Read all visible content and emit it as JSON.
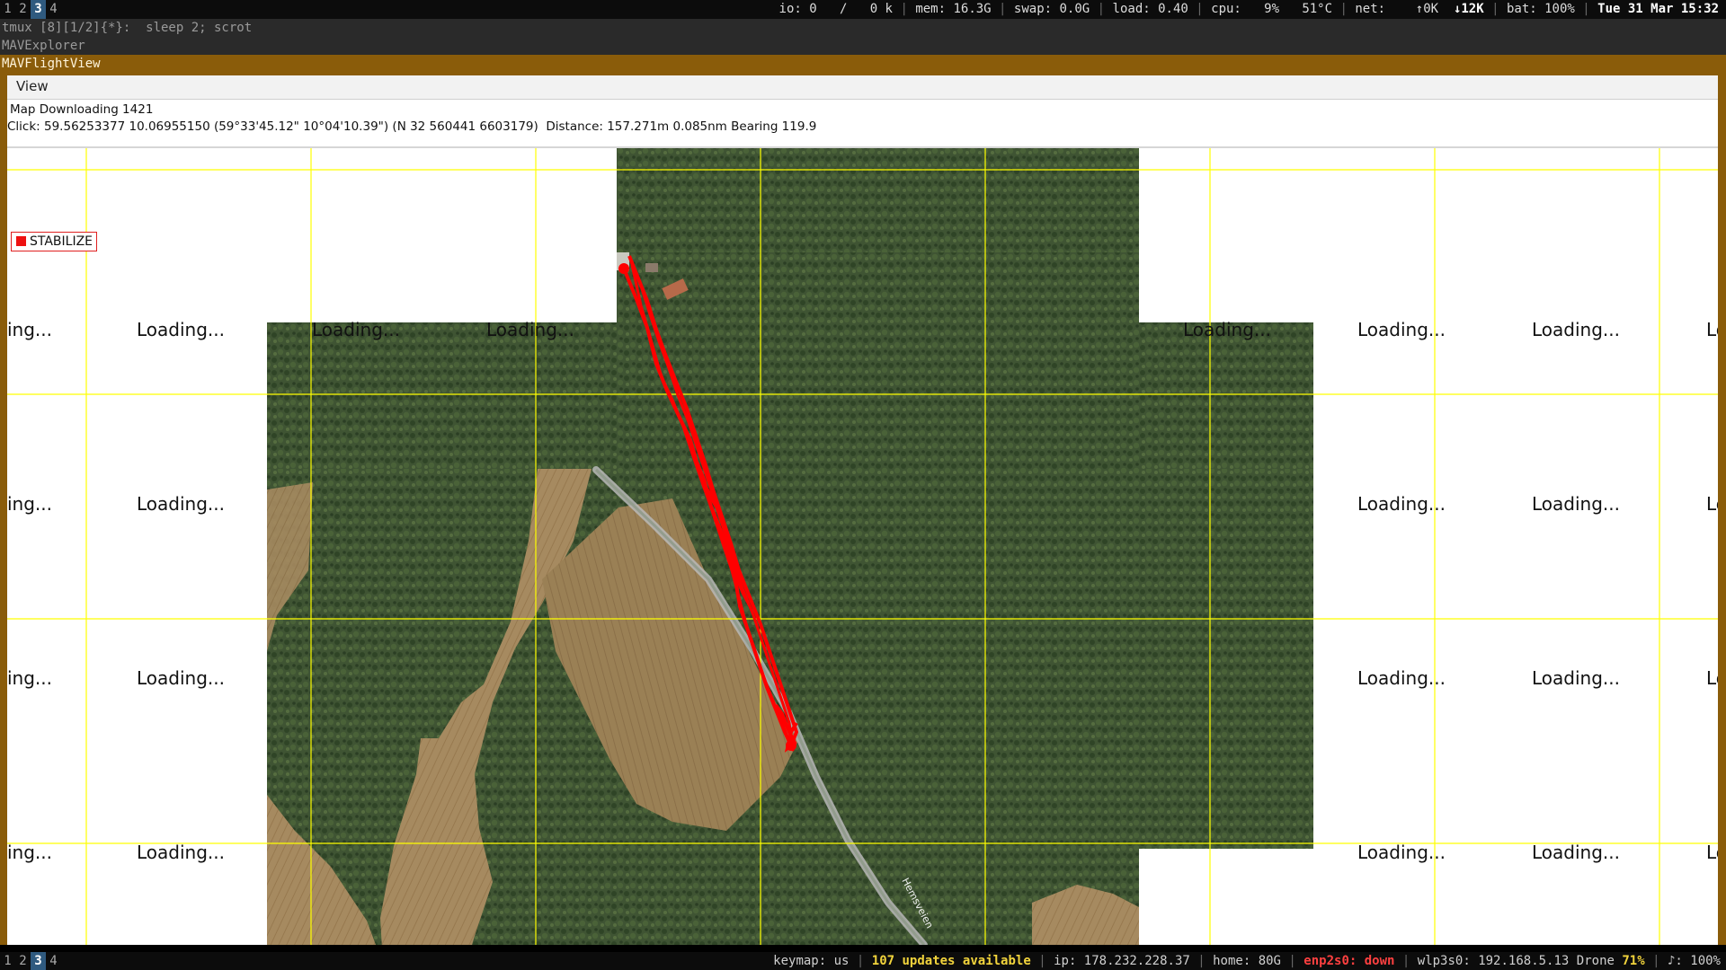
{
  "top_bar": {
    "workspaces": [
      {
        "label": "1",
        "active": false
      },
      {
        "label": "2",
        "active": false
      },
      {
        "label": "3",
        "active": true
      },
      {
        "label": "4",
        "active": false
      }
    ],
    "io_label": "io: 0",
    "io_slash": "/",
    "io_value": "0 k",
    "mem": "mem: 16.3G",
    "swap": "swap: 0.0G",
    "load": "load: 0.40",
    "cpu_label": "cpu:",
    "cpu_pct": "9%",
    "cpu_temp": "51°C",
    "net_label": "net:",
    "net_up": "↑0K",
    "net_down": "↓12K",
    "bat": "bat: 100%",
    "datetime": "Tue 31 Mar 15:32"
  },
  "terminal": {
    "tmux_line": "tmux [8][1/2]{*}:  sleep 2; scrot",
    "explorer_title": "MAVExplorer"
  },
  "window": {
    "title": "MAVFlightView",
    "menu_view": "View"
  },
  "info": {
    "line1": "Map Downloading 1421",
    "line2": "Click: 59.56253377 10.06955150 (59°33'45.12\" 10°04'10.39\") (N 32 560441 6603179)  Distance: 157.271m 0.085nm Bearing 119.9"
  },
  "map": {
    "mode_label": "STABILIZE",
    "loading_text": "Loading...",
    "loading_partial_left": "ing...",
    "loading_partial_right": "Lo",
    "road_label": "Hemsveien",
    "colors": {
      "grid": "#ffff00",
      "track": "#ff0000",
      "forest": "#3f5433",
      "field": "#a68a60"
    }
  },
  "bottom_bar": {
    "workspaces": [
      {
        "label": "1",
        "active": false
      },
      {
        "label": "2",
        "active": false
      },
      {
        "label": "3",
        "active": true
      },
      {
        "label": "4",
        "active": false
      }
    ],
    "keymap": "keymap: us",
    "updates": "107 updates available",
    "ip": "ip: 178.232.228.37",
    "home": "home: 80G",
    "eth": "enp2s0: down",
    "wifi": "wlp3s0: 192.168.5.13",
    "wifi_name": "Drone",
    "wifi_pct": "71%",
    "volume": "♪: 100%"
  }
}
